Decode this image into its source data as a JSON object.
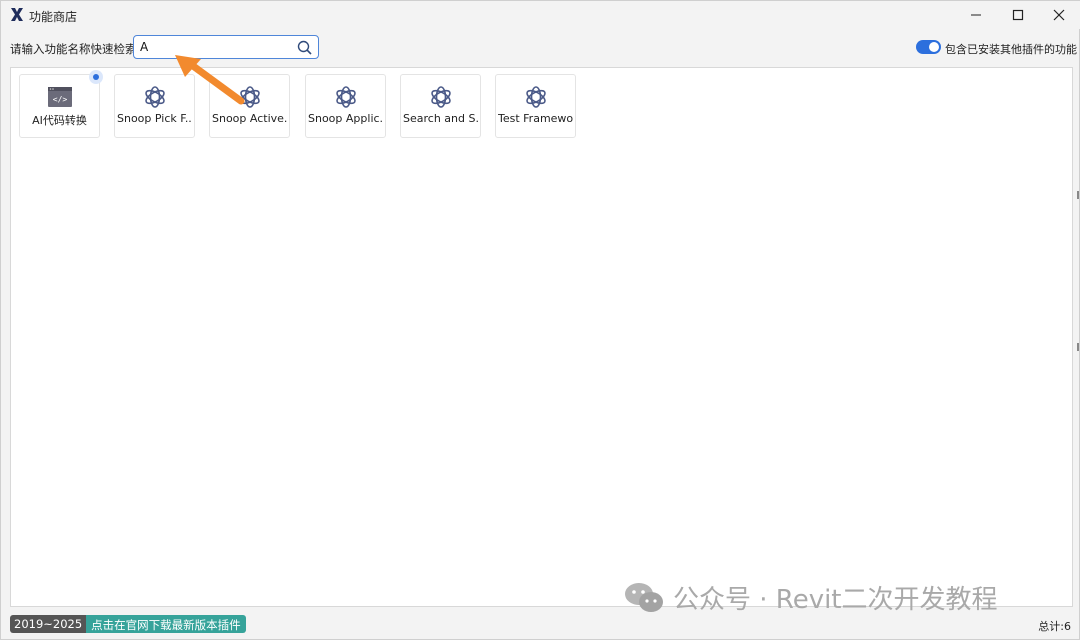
{
  "window": {
    "title": "功能商店",
    "controls": {
      "minimize": "minimize",
      "maximize": "maximize",
      "close": "close"
    }
  },
  "toolbar": {
    "search_label": "请输入功能名称快速检索:",
    "search_value": "A",
    "toggle_on": true,
    "toggle_label": "包含已安装其他插件的功能"
  },
  "cards": [
    {
      "label": "AI代码转换",
      "icon": "code-window-icon",
      "has_badge": true
    },
    {
      "label": "Snoop Pick F...",
      "icon": "openai-icon",
      "has_badge": false
    },
    {
      "label": "Snoop Active...",
      "icon": "openai-icon",
      "has_badge": false
    },
    {
      "label": "Snoop Applic...",
      "icon": "openai-icon",
      "has_badge": false
    },
    {
      "label": "Search and S...",
      "icon": "openai-icon",
      "has_badge": false
    },
    {
      "label": "Test Framewo...",
      "icon": "openai-icon",
      "has_badge": false
    }
  ],
  "footer": {
    "version_range": "2019~2025",
    "download_link": "点击在官网下载最新版本插件",
    "total": "总计:6"
  },
  "watermark": {
    "text": "公众号 · Revit二次开发教程"
  },
  "colors": {
    "accent": "#2c6fdd",
    "arrow": "#f28a2e",
    "tag_dark": "#555555",
    "tag_teal": "#36a39a"
  }
}
